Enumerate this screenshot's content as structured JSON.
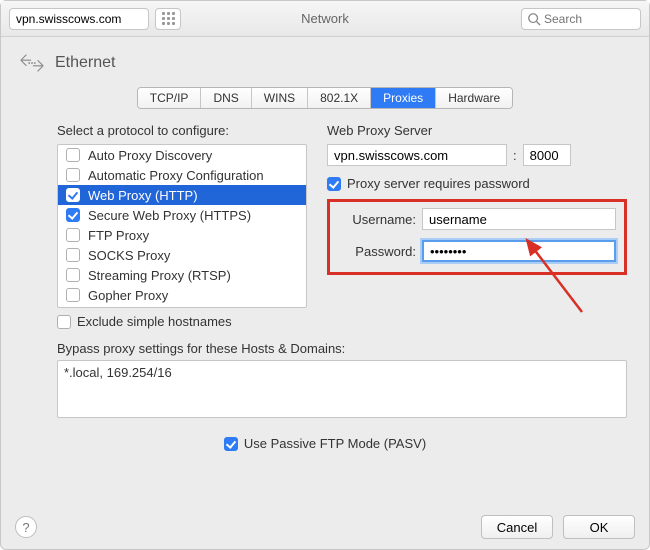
{
  "titlebar": {
    "url": "vpn.swisscows.com",
    "title": "Network",
    "search_placeholder": "Search"
  },
  "service": {
    "name": "Ethernet"
  },
  "tabs": [
    {
      "label": "TCP/IP",
      "selected": false
    },
    {
      "label": "DNS",
      "selected": false
    },
    {
      "label": "WINS",
      "selected": false
    },
    {
      "label": "802.1X",
      "selected": false
    },
    {
      "label": "Proxies",
      "selected": true
    },
    {
      "label": "Hardware",
      "selected": false
    }
  ],
  "left": {
    "select_label": "Select a protocol to configure:",
    "protocols": [
      {
        "label": "Auto Proxy Discovery",
        "checked": false,
        "selected": false
      },
      {
        "label": "Automatic Proxy Configuration",
        "checked": false,
        "selected": false
      },
      {
        "label": "Web Proxy (HTTP)",
        "checked": true,
        "selected": true
      },
      {
        "label": "Secure Web Proxy (HTTPS)",
        "checked": true,
        "selected": false
      },
      {
        "label": "FTP Proxy",
        "checked": false,
        "selected": false
      },
      {
        "label": "SOCKS Proxy",
        "checked": false,
        "selected": false
      },
      {
        "label": "Streaming Proxy (RTSP)",
        "checked": false,
        "selected": false
      },
      {
        "label": "Gopher Proxy",
        "checked": false,
        "selected": false
      }
    ],
    "exclude_label": "Exclude simple hostnames",
    "exclude_checked": false
  },
  "bypass": {
    "label": "Bypass proxy settings for these Hosts & Domains:",
    "value": "*.local, 169.254/16"
  },
  "right": {
    "server_label": "Web Proxy Server",
    "server_host": "vpn.swisscows.com",
    "server_sep": ":",
    "server_port": "8000",
    "requires_pw_label": "Proxy server requires password",
    "requires_pw_checked": true,
    "username_label": "Username:",
    "username_value": "username",
    "password_label": "Password:",
    "password_value": "••••••••"
  },
  "pasv": {
    "checked": true,
    "label": "Use Passive FTP Mode (PASV)"
  },
  "footer": {
    "help": "?",
    "cancel": "Cancel",
    "ok": "OK"
  }
}
